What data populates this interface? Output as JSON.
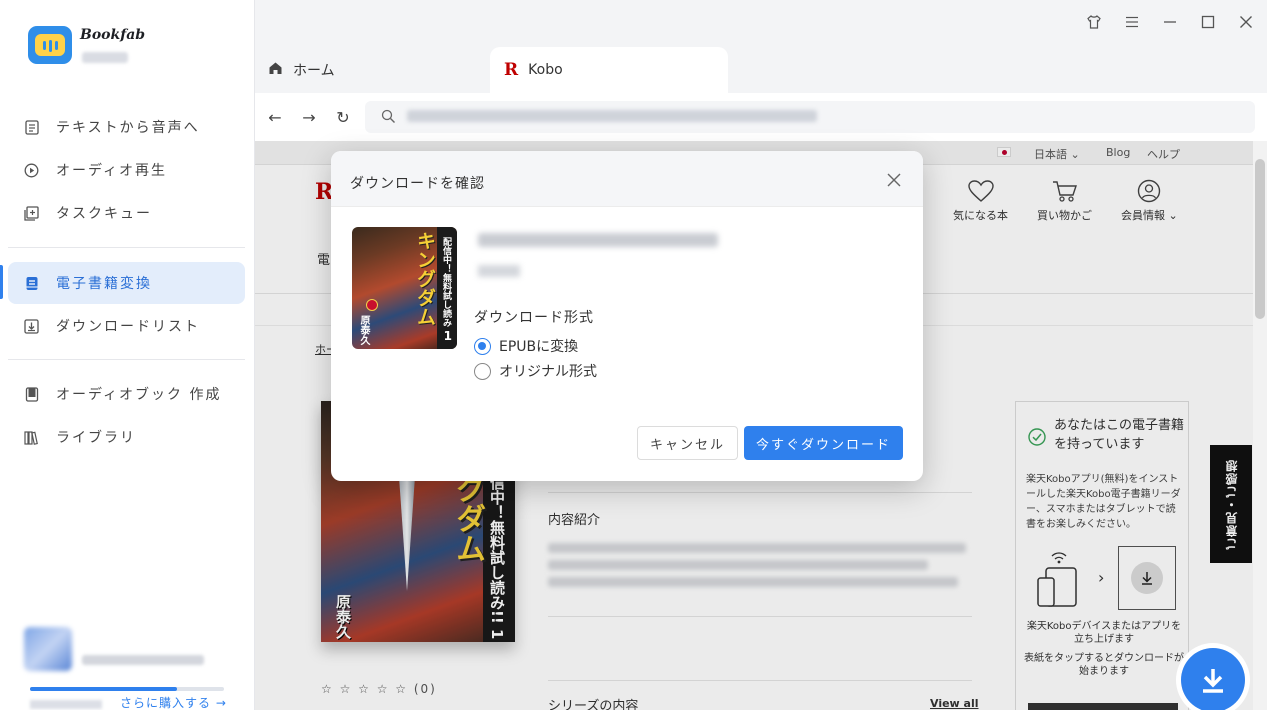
{
  "app": {
    "brand": "Bookfab",
    "buy_more": "さらに購入する →",
    "progress_fraction": 0.76
  },
  "sidebar": {
    "items": [
      {
        "label": "テキストから音声へ",
        "icon": "document-icon"
      },
      {
        "label": "オーディオ再生",
        "icon": "play-circle-icon"
      },
      {
        "label": "タスクキュー",
        "icon": "add-task-icon"
      },
      {
        "label": "電子書籍変換",
        "icon": "ebook-icon",
        "active": true
      },
      {
        "label": "ダウンロードリスト",
        "icon": "download-list-icon"
      },
      {
        "label": "オーディオブック 作成",
        "icon": "audiobook-icon"
      },
      {
        "label": "ライブラリ",
        "icon": "library-icon"
      }
    ]
  },
  "tabs": [
    {
      "label": "ホーム",
      "icon": "home-icon"
    },
    {
      "label": "Kobo",
      "icon": "kobo-r-icon",
      "glyph": "R",
      "active": true
    }
  ],
  "browser": {
    "back": "←",
    "forward": "→",
    "reload": "↻"
  },
  "kobo_page": {
    "logo": "R",
    "language": "日本語 ⌄",
    "blog": "Blog",
    "help": "ヘルプ",
    "wishlist": "気になる本",
    "cart": "買い物かご",
    "account": "会員情報 ⌄",
    "nav_fragment": "電",
    "breadcrumb": "ホー",
    "rating": "☆ ☆ ☆ ☆ ☆ (0)",
    "description_heading": "内容紹介",
    "series_heading": "シリーズの内容",
    "view_all": "View all",
    "cover_title": "グダム",
    "cover_side": "信中！無料試し読み!! 1",
    "cover_author": "原泰久",
    "own_title": "あなたはこの電子書籍を持っています",
    "own_desc": "楽天Koboアプリ(無料)をインストールした楽天Kobo電子書籍リーダー、スマホまたはタブレットで読書をお楽しみください。",
    "own_note1": "楽天Koboデバイスまたはアプリを立ち上げます",
    "own_note2": "表紙をタップするとダウンロードが始まります",
    "feedback": "ご意見・ご感想"
  },
  "modal": {
    "title": "ダウンロードを確認",
    "format_label": "ダウンロード形式",
    "options": [
      {
        "label": "EPUBに変換",
        "selected": true
      },
      {
        "label": "オリジナル形式",
        "selected": false
      }
    ],
    "cancel": "キャンセル",
    "confirm": "今すぐダウンロード",
    "cover": {
      "title": "キングダム",
      "side": "配信中！無料試し読み",
      "author": "原泰久",
      "volume": "1"
    }
  },
  "colors": {
    "accent": "#2f80ed",
    "active_bg": "#e3edfb",
    "kobo_red": "#bf0000"
  }
}
